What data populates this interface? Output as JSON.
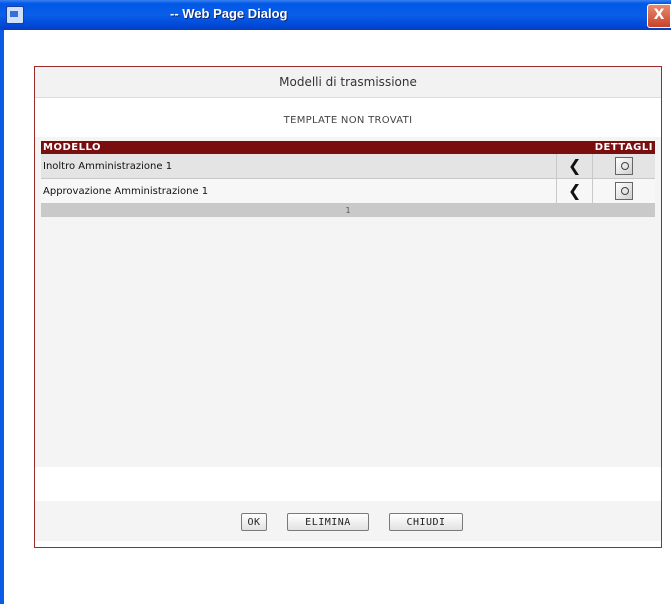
{
  "window": {
    "title": "-- Web Page Dialog",
    "close_label": "X"
  },
  "dialog": {
    "header": "Modelli di trasmissione",
    "notice": "TEMPLATE NON TROVATI",
    "table": {
      "columns": [
        "MODELLO",
        "",
        "DETTAGLI"
      ],
      "rows": [
        {
          "modello": "Inoltro Amministrazione 1",
          "action_icon": "left-arrow-icon",
          "details_icon": "details-icon"
        },
        {
          "modello": "Approvazione Amministrazione 1",
          "action_icon": "left-arrow-icon",
          "details_icon": "details-icon"
        }
      ],
      "page": "1"
    },
    "buttons": {
      "ok": "OK",
      "elimina": "ELIMINA",
      "chiudi": "CHIUDI"
    }
  }
}
